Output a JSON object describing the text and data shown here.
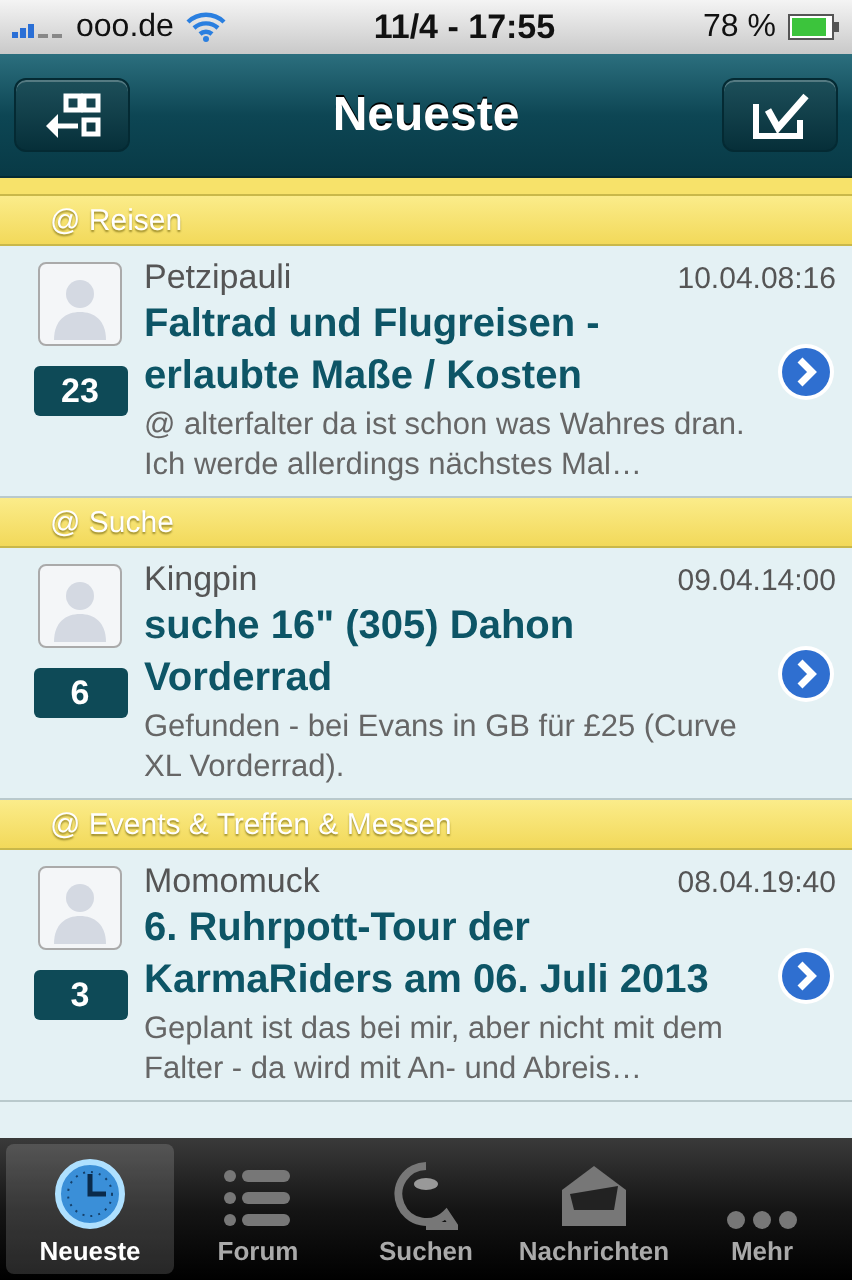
{
  "status_bar": {
    "carrier": "ooo.de",
    "time": "11/4 - 17:55",
    "battery": "78 %"
  },
  "nav_bar": {
    "title": "Neueste"
  },
  "sections": [
    {
      "header": "@ Reisen",
      "posts": [
        {
          "author": "Petzipauli",
          "date": "10.04.08:16",
          "title": "Faltrad und Flugreisen - erlaubte Maße / Kosten",
          "replies": "23",
          "preview": "@ alterfalter da ist schon was Wahres dran. Ich werde allerdings nächstes Mal…"
        }
      ]
    },
    {
      "header": "@ Suche",
      "posts": [
        {
          "author": "Kingpin",
          "date": "09.04.14:00",
          "title": "suche 16\" (305) Dahon Vorderrad",
          "replies": "6",
          "preview": "Gefunden - bei Evans in GB für £25 (Curve XL Vorderrad)."
        }
      ]
    },
    {
      "header": "@ Events & Treffen & Messen",
      "posts": [
        {
          "author": "Momomuck",
          "date": "08.04.19:40",
          "title": "6. Ruhrpott-Tour der KarmaRiders am 06. Juli 2013",
          "replies": "3",
          "preview": "Geplant ist das bei mir, aber nicht mit dem Falter - da wird mit An- und Abreis…"
        }
      ]
    }
  ],
  "tab_bar": [
    {
      "label": "Neueste",
      "kind": "clock",
      "selected": true
    },
    {
      "label": "Forum",
      "kind": "list",
      "selected": false
    },
    {
      "label": "Suchen",
      "kind": "search",
      "selected": false
    },
    {
      "label": "Nachrichten",
      "kind": "mail",
      "selected": false
    },
    {
      "label": "Mehr",
      "kind": "more",
      "selected": false
    }
  ]
}
